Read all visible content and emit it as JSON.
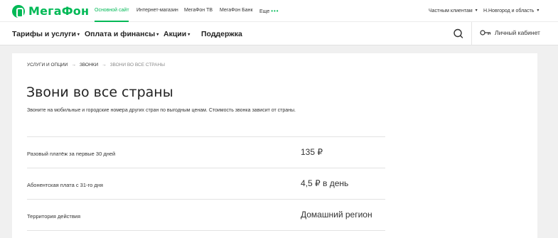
{
  "brand": {
    "name": "МегаФон",
    "color": "#00b956"
  },
  "top_nav": {
    "items": [
      {
        "label": "Основной сайт",
        "active": true
      },
      {
        "label": "Интернет-магазин"
      },
      {
        "label": "МегаФон ТВ"
      },
      {
        "label": "МегаФон Банк"
      }
    ],
    "more_label": "Еще",
    "more_dots": "•••",
    "audience": "Частным клиентам",
    "region": "Н.Новгород и область"
  },
  "main_nav": {
    "items": [
      "Тарифы и услуги",
      "Оплата и финансы",
      "Акции",
      "Поддержка"
    ],
    "search_icon": "search-icon",
    "cabinet_label": "Личный кабинет",
    "cabinet_icon": "key-icon"
  },
  "breadcrumb": [
    "УСЛУГИ И ОПЦИИ",
    "ЗВОНКИ",
    "ЗВОНИ ВО ВСЕ СТРАНЫ"
  ],
  "breadcrumb_separator": "→",
  "page": {
    "title": "Звони во все страны",
    "subtitle": "Звоните на мобильные и городские номера других стран по выгодным ценам. Стоимость звонка зависит от страны."
  },
  "details": [
    {
      "label": "Разовый платёж за первые 30 дней",
      "value": "135 ₽"
    },
    {
      "label": "Абонентская плата с 31-го дня",
      "value": "4,5 ₽ в день"
    },
    {
      "label": "Территория действия",
      "value": "Домашний регион"
    }
  ]
}
